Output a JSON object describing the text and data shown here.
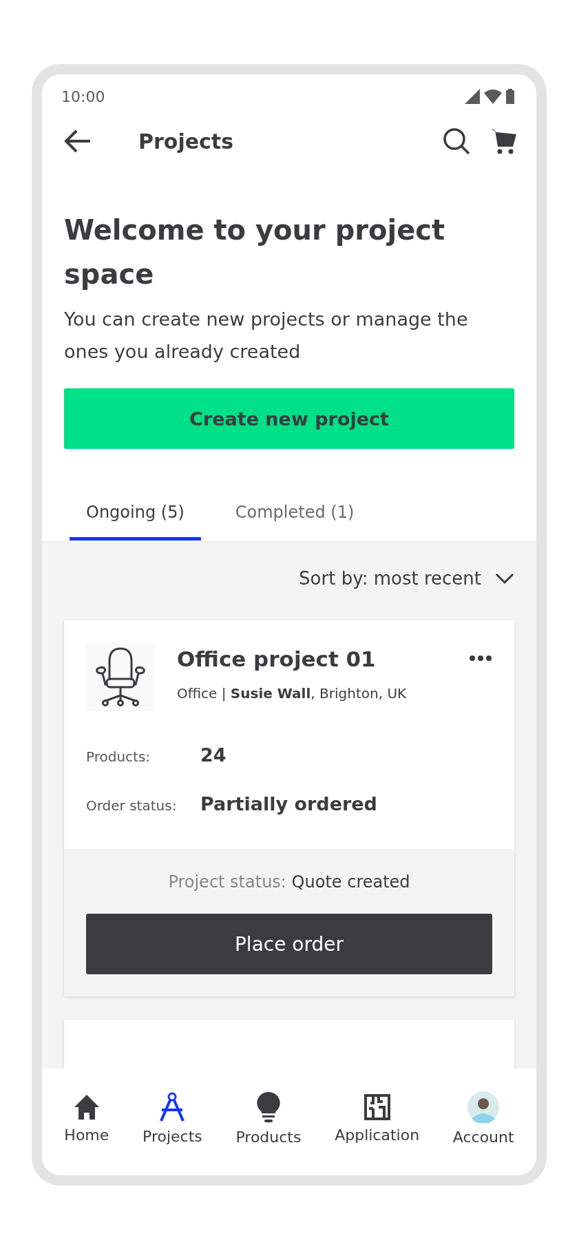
{
  "status_bar": {
    "time": "10:00"
  },
  "header": {
    "title": "Projects"
  },
  "intro": {
    "heading": "Welcome to your project space",
    "text": "You can create new projects or manage the ones you already created"
  },
  "create_button": "Create new project",
  "tabs": [
    {
      "label": "Ongoing (5)",
      "selected": true
    },
    {
      "label": "Completed (1)",
      "selected": false
    }
  ],
  "sort": {
    "label": "Sort by: most recent"
  },
  "projects": [
    {
      "title": "Office project 01",
      "category": "Office |",
      "client": "Susie Wall",
      "location": ", Brighton, UK",
      "products_label": "Products:",
      "products": "24",
      "order_status_label": "Order status:",
      "order_status": "Partially ordered",
      "project_status_label": "Project status:",
      "project_status": "Quote created",
      "action": "Place order"
    }
  ],
  "bottom_nav": [
    {
      "label": "Home",
      "kind": "home",
      "selected": false
    },
    {
      "label": "Projects",
      "kind": "projects",
      "selected": true
    },
    {
      "label": "Products",
      "kind": "products",
      "selected": false
    },
    {
      "label": "Application",
      "kind": "application",
      "selected": false
    },
    {
      "label": "Account",
      "kind": "account",
      "selected": false
    }
  ]
}
